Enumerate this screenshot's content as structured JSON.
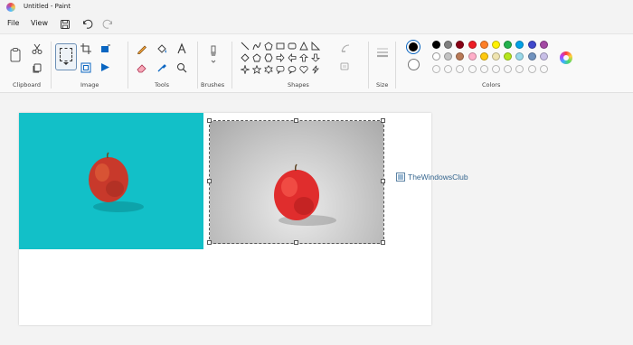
{
  "window": {
    "title": "Untitled - Paint"
  },
  "menu": {
    "file": "File",
    "view": "View"
  },
  "groups": {
    "clipboard": "Clipboard",
    "image": "Image",
    "tools": "Tools",
    "brushes": "Brushes",
    "shapes": "Shapes",
    "size": "Size",
    "colors": "Colors"
  },
  "colors": {
    "primary": "#000000",
    "secondary": "#ffffff",
    "palette_row1": [
      "#000000",
      "#7f7f7f",
      "#880015",
      "#ed1c24",
      "#ff7f27",
      "#fff200",
      "#22b14c",
      "#00a2e8",
      "#3f48cc",
      "#a349a4"
    ],
    "palette_row2": [
      "#ffffff",
      "#c3c3c3",
      "#b97a57",
      "#ffaec9",
      "#ffc90e",
      "#efe4b0",
      "#b5e61d",
      "#99d9ea",
      "#7092be",
      "#c8bfe7"
    ]
  },
  "canvas": {
    "left_image_background": "#12c0c8",
    "right_image_background": "#c8c8c8"
  },
  "watermark": {
    "text": "TheWindowsClub"
  }
}
